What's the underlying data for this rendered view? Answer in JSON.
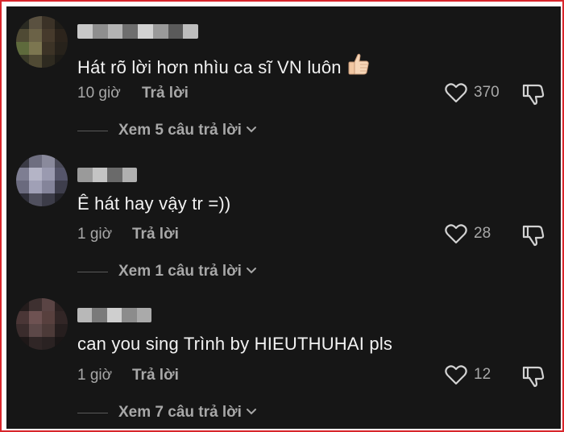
{
  "comments": [
    {
      "text": "Hát rõ lời hơn nhìu ca sĩ VN luôn",
      "emoji_icon": "thumbs-up-icon",
      "time": "10 giờ",
      "reply_label": "Trả lời",
      "like_count": "370",
      "view_replies_label": "Xem 5 câu trả lời"
    },
    {
      "text": "Ê hát hay vậy tr =))",
      "time": "1 giờ",
      "reply_label": "Trả lời",
      "like_count": "28",
      "view_replies_label": "Xem 1 câu trả lời"
    },
    {
      "text": "can you sing Trình by HIEUTHUHAI pls",
      "time": "1 giờ",
      "reply_label": "Trả lời",
      "like_count": "12",
      "view_replies_label": "Xem 7 câu trả lời"
    }
  ],
  "colors": {
    "background": "#161616",
    "primary_text": "#f2f2f2",
    "secondary_text": "#a8a8a8",
    "frame_border": "#d8262c"
  }
}
